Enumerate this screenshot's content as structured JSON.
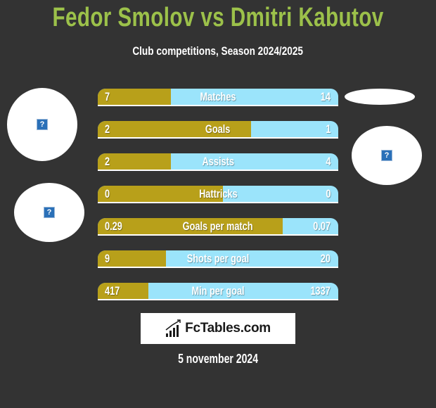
{
  "header": {
    "title": "Fedor Smolov vs Dmitri Kabutov",
    "subtitle": "Club competitions, Season 2024/2025"
  },
  "colors": {
    "background": "#333333",
    "title": "#9cc14a",
    "left_player": "#b8a01a",
    "right_player": "#9be4fb",
    "text": "#ffffff"
  },
  "avatars": {
    "left_top": {
      "icon": "broken-image-icon",
      "glyph": "?"
    },
    "left_bottom": {
      "icon": "broken-image-icon",
      "glyph": "?"
    },
    "right_top": {
      "icon": "blank-oval"
    },
    "right_bottom": {
      "icon": "broken-image-icon",
      "glyph": "?"
    }
  },
  "stats": [
    {
      "label": "Matches",
      "left": "7",
      "right": "14",
      "left_share": 0.304
    },
    {
      "label": "Goals",
      "left": "2",
      "right": "1",
      "left_share": 0.637
    },
    {
      "label": "Assists",
      "left": "2",
      "right": "4",
      "left_share": 0.304
    },
    {
      "label": "Hattricks",
      "left": "0",
      "right": "0",
      "left_share": 0.52
    },
    {
      "label": "Goals per match",
      "left": "0.29",
      "right": "0.07",
      "left_share": 0.769
    },
    {
      "label": "Shots per goal",
      "left": "9",
      "right": "20",
      "left_share": 0.284
    },
    {
      "label": "Min per goal",
      "left": "417",
      "right": "1337",
      "left_share": 0.211
    }
  ],
  "footer": {
    "logo_text": "FcTables.com",
    "logo_icon": "bar-chart-icon",
    "date": "5 november 2024"
  }
}
